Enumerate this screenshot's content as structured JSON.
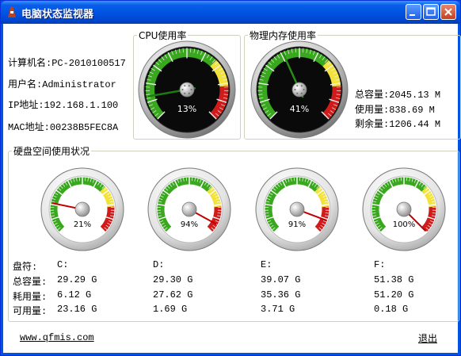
{
  "window": {
    "title": "电脑状态监视器"
  },
  "computer": {
    "name_label": "计算机名:",
    "name_value": "PC-2010100517",
    "user_label": "用户名:",
    "user_value": "Administrator",
    "ip_label": "IP地址:",
    "ip_value": "192.168.1.100",
    "mac_label": "MAC地址:",
    "mac_value": "00238B5FEC8A"
  },
  "cpu": {
    "title": "CPU使用率",
    "percent_label": "13%",
    "value": 13
  },
  "memory": {
    "title": "物理内存使用率",
    "percent_label": "41%",
    "value": 41,
    "total_label": "总容量:",
    "total_value": "2045.13 M",
    "used_label": "使用量:",
    "used_value": "838.69 M",
    "free_label": "剩余量:",
    "free_value": "1206.44 M"
  },
  "disk": {
    "title": "硬盘空间使用状况",
    "row_labels": {
      "drive": "盘符:",
      "total": "总容量:",
      "used": "耗用量:",
      "free": "可用量:"
    },
    "drives": [
      {
        "letter": "C:",
        "percent_label": "21%",
        "value": 21,
        "total": "29.29 G",
        "used": "6.12 G",
        "free": "23.16 G"
      },
      {
        "letter": "D:",
        "percent_label": "94%",
        "value": 94,
        "total": "29.30 G",
        "used": "27.62 G",
        "free": "1.69 G"
      },
      {
        "letter": "E:",
        "percent_label": "91%",
        "value": 91,
        "total": "39.07 G",
        "used": "35.36 G",
        "free": "3.71 G"
      },
      {
        "letter": "F:",
        "percent_label": "100%",
        "value": 100,
        "total": "51.38 G",
        "used": "51.20 G",
        "free": "0.18 G"
      }
    ]
  },
  "footer": {
    "website": "www.qfmis.com",
    "exit": "退出"
  },
  "colors": {
    "gauge_green": "#3aa81e",
    "gauge_yellow": "#f2e23a",
    "gauge_red": "#d11a1a",
    "needle": "#c00000",
    "cpu_needle": "#1e7a14"
  }
}
